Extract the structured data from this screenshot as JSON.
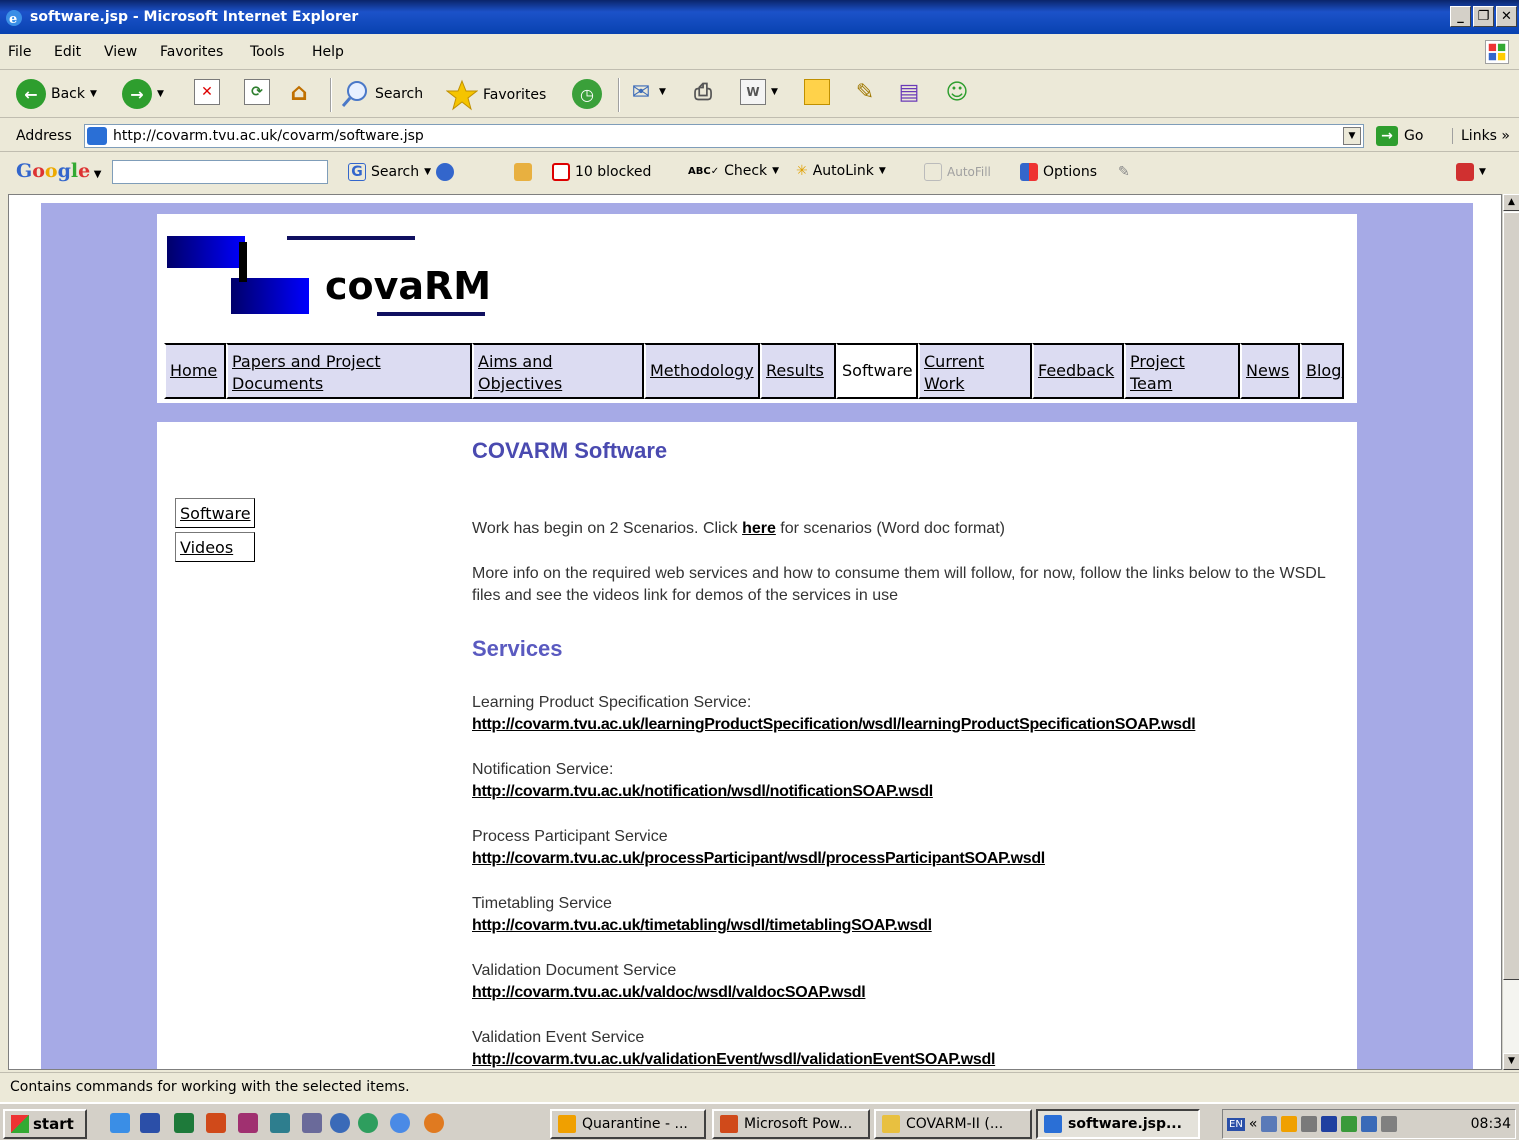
{
  "window": {
    "title": "software.jsp - Microsoft Internet Explorer",
    "controls": [
      "_",
      "Д",
      "X"
    ]
  },
  "menu": {
    "items": [
      "File",
      "Edit",
      "View",
      "Favorites",
      "Tools",
      "Help"
    ]
  },
  "toolbar": {
    "back": "Back",
    "search": "Search",
    "favorites": "Favorites"
  },
  "address": {
    "label": "Address",
    "url": "http://covarm.tvu.ac.uk/covarm/software.jsp",
    "go": "Go",
    "links": "Links"
  },
  "google": {
    "logo": "Google",
    "search": "Search",
    "blocked": "10 blocked",
    "check": "Check",
    "autolink": "AutoLink",
    "autofill": "AutoFill",
    "options": "Options"
  },
  "site": {
    "logo_text": "covaRM",
    "nav": [
      {
        "label": "Home"
      },
      {
        "label": "Papers and Project Documents"
      },
      {
        "label": "Aims and Objectives"
      },
      {
        "label": "Methodology"
      },
      {
        "label": "Results"
      },
      {
        "label": "Software"
      },
      {
        "label": "Current Work"
      },
      {
        "label": "Feedback"
      },
      {
        "label": "Project Team"
      },
      {
        "label": "News"
      },
      {
        "label": "Blog"
      }
    ],
    "side_links": [
      "Software",
      "Videos"
    ],
    "heading": "COVARM Software",
    "intro_before": "Work has begin on 2 Scenarios. Click ",
    "intro_link": "here",
    "intro_after": " for scenarios (Word doc format)",
    "info": "More info on the required web services and how to consume them will follow, for now, follow the links below to the WSDL files and see the videos link for demos of the services in use",
    "services_heading": "Services",
    "services": [
      {
        "name": "Learning Product Specification Service:",
        "url": "http://covarm.tvu.ac.uk/learningProductSpecification/wsdl/learningProductSpecificationSOAP.wsdl"
      },
      {
        "name": "Notification Service:",
        "url": "http://covarm.tvu.ac.uk/notification/wsdl/notificationSOAP.wsdl"
      },
      {
        "name": "Process Participant Service",
        "url": "http://covarm.tvu.ac.uk/processParticipant/wsdl/processParticipantSOAP.wsdl"
      },
      {
        "name": "Timetabling Service",
        "url": "http://covarm.tvu.ac.uk/timetabling/wsdl/timetablingSOAP.wsdl"
      },
      {
        "name": "Validation Document Service",
        "url": "http://covarm.tvu.ac.uk/valdoc/wsdl/valdocSOAP.wsdl"
      },
      {
        "name": "Validation Event Service",
        "url": "http://covarm.tvu.ac.uk/validationEvent/wsdl/validationEventSOAP.wsdl"
      }
    ]
  },
  "status": {
    "text": "Contains commands for working with the selected items."
  },
  "taskbar": {
    "start": "start",
    "tasks": [
      {
        "label": "Quarantine - ...",
        "icon_color": "#f0a000"
      },
      {
        "label": "Microsoft Pow...",
        "icon_color": "#d04a1a"
      },
      {
        "label": "COVARM-II (...",
        "icon_color": "#e8c040"
      },
      {
        "label": "software.jsp...",
        "icon_color": "#2a6fd6"
      }
    ],
    "lang": "EN",
    "clock": "08:34"
  }
}
